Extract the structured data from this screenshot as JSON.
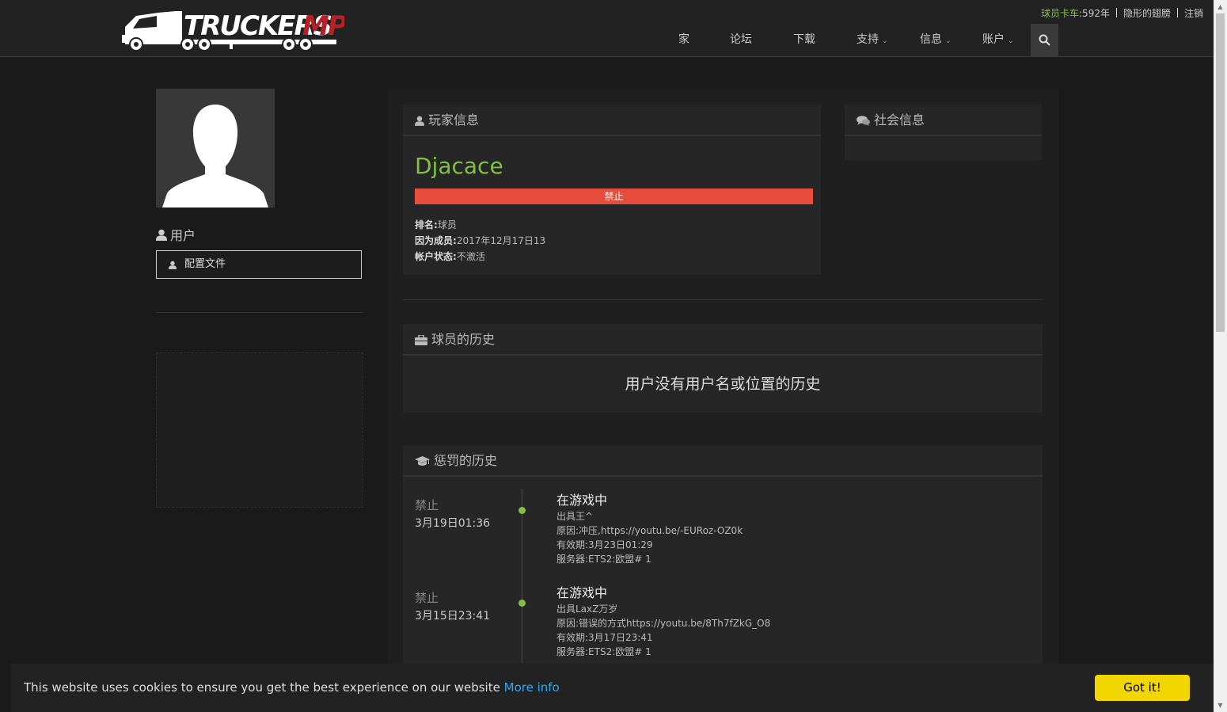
{
  "header": {
    "logo_text": "TRUCKERSMP",
    "top_links": {
      "players_label": "球员卡车",
      "players_count": ":592年",
      "link_2": "隐形的翅膀",
      "logout": "注销"
    },
    "nav": [
      {
        "label": "家",
        "dropdown": false
      },
      {
        "label": "论坛",
        "dropdown": false
      },
      {
        "label": "下载",
        "dropdown": false
      },
      {
        "label": "支持",
        "dropdown": true
      },
      {
        "label": "信息",
        "dropdown": true
      },
      {
        "label": "账户",
        "dropdown": true
      }
    ],
    "search_icon": "search-icon"
  },
  "sidebar": {
    "user_heading": "用户",
    "profile_button": "配置文件"
  },
  "player_info": {
    "heading": "玩家信息",
    "name": "Djacace",
    "status_bar": "禁止",
    "rank_label": "排名:",
    "rank_value": "球员",
    "member_since_label": "因为成员:",
    "member_since_value": "2017年12月17日13",
    "account_status_label": "帐户状态:",
    "account_status_value": "不激活"
  },
  "social_info": {
    "heading": "社会信息"
  },
  "player_history": {
    "heading": "球员的历史",
    "message": "用户没有用户名或位置的历史"
  },
  "punishment_history": {
    "heading": "惩罚的历史",
    "entries": [
      {
        "type": "禁止",
        "date": "3月19日01:36",
        "title": "在游戏中",
        "issued_by": "出具王^",
        "reason": "原因:冲压,https://youtu.be/-EURoz-OZ0k",
        "expires": "有效期:3月23日01:29",
        "server": "服务器:ETS2:欧盟# 1"
      },
      {
        "type": "禁止",
        "date": "3月15日23:41",
        "title": "在游戏中",
        "issued_by": "出具LaxZ万岁",
        "reason": "原因:错误的方式https://youtu.be/8Th7fZkG_O8",
        "expires": "有效期:3月17日23:41",
        "server": "服务器:ETS2:欧盟# 1"
      }
    ]
  },
  "cookie": {
    "text": "This website uses cookies to ensure you get the best experience on our website",
    "link": "More info",
    "button": "Got it!"
  },
  "colors": {
    "accent_green": "#7fc242",
    "ban_red": "#e74c3c",
    "cookie_button": "#f1d600",
    "link_blue": "#31a8f0"
  }
}
